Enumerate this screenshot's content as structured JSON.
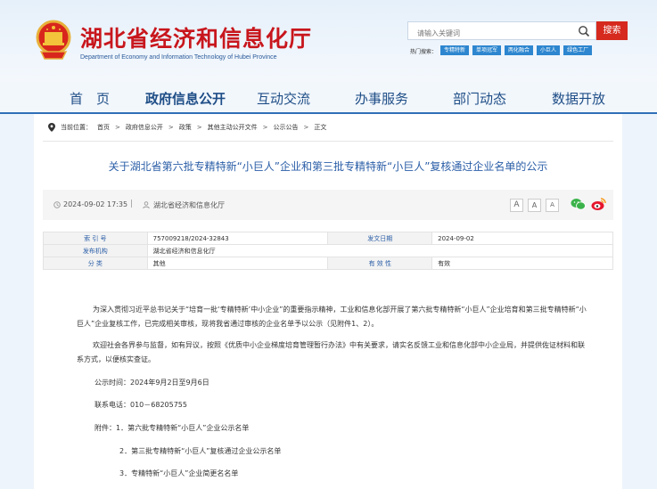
{
  "header": {
    "site_title": "湖北省经济和信息化厅",
    "site_subtitle": "Department of Economy and Information Technology of Hubei Province",
    "search_placeholder": "请输入关键词",
    "search_button": "搜索",
    "hot_label": "热门搜索：",
    "hot_tags": [
      "专精特新",
      "单项冠军",
      "两化融合",
      "小巨人",
      "绿色工厂"
    ]
  },
  "nav": {
    "items": [
      "首　页",
      "政府信息公开",
      "互动交流",
      "办事服务",
      "部门动态",
      "数据开放"
    ]
  },
  "breadcrumb": {
    "label": "当前位置：",
    "items": [
      "首页",
      "政府信息公开",
      "政策",
      "其他主动公开文件",
      "公示公告",
      "正文"
    ],
    "separator": ">"
  },
  "article": {
    "title": "关于湖北省第六批专精特新“小巨人”企业和第三批专精特新“小巨人”复核通过企业名单的公示",
    "date": "2024-09-02 17:35",
    "divider": "|",
    "source": "湖北省经济和信息化厅",
    "font_sizes": [
      "A",
      "A",
      "A"
    ]
  },
  "info_table": {
    "row1": {
      "l1": "索  引  号",
      "v1": "757009218/2024-32843",
      "l2": "发文日期",
      "v2": "2024-09-02"
    },
    "row2": {
      "l1": "发布机构",
      "v1": "湖北省经济和信息化厅"
    },
    "row3": {
      "l1": "分        类",
      "v1": "其他",
      "l2": "有  效  性",
      "v2": "有效"
    }
  },
  "content": {
    "p1": "为深入贯彻习近平总书记关于“培育一批‘专精特新’中小企业”的重要指示精神，工业和信息化部开展了第六批专精特新“小巨人”企业培育和第三批专精特新“小巨人”企业复核工作，已完成相关审核，现将我省通过审核的企业名单予以公示（见附件1、2）。",
    "p2": "欢迎社会各界参与监督，如有异议，按照《优质中小企业梯度培育管理暂行办法》中有关要求，请实名反馈工业和信息化部中小企业局，并提供佐证材料和联系方式，以便核实查证。",
    "p3": "公示时间：2024年9月2日至9月6日",
    "p4": "联系电话：010－68205755",
    "a1": "附件：1．第六批专精特新“小巨人”企业公示名单",
    "a2": "2．第三批专精特新“小巨人”复核通过企业公示名单",
    "a3": "3．专精特新“小巨人”企业简更名名单"
  }
}
